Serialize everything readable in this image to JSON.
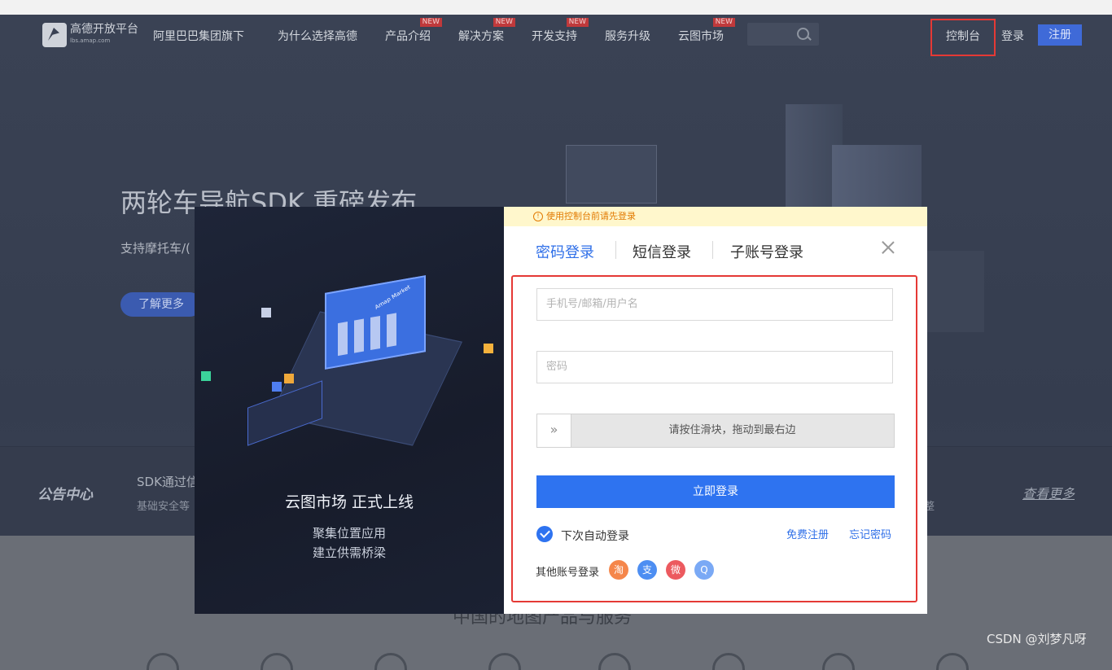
{
  "nav": {
    "logo_name": "高德开放平台",
    "logo_sub": "lbs.amap.com",
    "group": "阿里巴巴集团旗下",
    "items": [
      {
        "label": "为什么选择高德",
        "new": false
      },
      {
        "label": "产品介绍",
        "new": true
      },
      {
        "label": "解决方案",
        "new": true
      },
      {
        "label": "开发支持",
        "new": true
      },
      {
        "label": "服务升级",
        "new": false
      },
      {
        "label": "云图市场",
        "new": true
      }
    ],
    "new_badge": "NEW",
    "console": "控制台",
    "login": "登录",
    "register": "注册"
  },
  "hero": {
    "title": "两轮车导航SDK 重磅发布",
    "subtitle": "支持摩托车/(",
    "button": "了解更多"
  },
  "notice": {
    "label": "公告中心",
    "headline": "SDK通过信",
    "sub": "基础安全等",
    "sub_right": "整",
    "more": "查看更多"
  },
  "below": {
    "title": "中国的地图产品与服务"
  },
  "watermark": "CSDN @刘梦凡呀",
  "modal": {
    "promo": {
      "title": "云图市场 正式上线",
      "line1": "聚集位置应用",
      "line2": "建立供需桥梁",
      "sign": "Amap Market"
    },
    "warning": "使用控制台前请先登录",
    "tabs": [
      "密码登录",
      "短信登录",
      "子账号登录"
    ],
    "username_placeholder": "手机号/邮箱/用户名",
    "password_placeholder": "密码",
    "slider_handle": "»",
    "slider_text": "请按住滑块，拖动到最右边",
    "submit": "立即登录",
    "auto_login": "下次自动登录",
    "free_register": "免费注册",
    "forgot_password": "忘记密码",
    "other_login": "其他账号登录",
    "social": [
      {
        "name": "taobao-icon",
        "glyph": "淘",
        "color": "#f5864a"
      },
      {
        "name": "alipay-icon",
        "glyph": "支",
        "color": "#4d8ef2"
      },
      {
        "name": "weibo-icon",
        "glyph": "微",
        "color": "#ec5a5f"
      },
      {
        "name": "qq-icon",
        "glyph": "Q",
        "color": "#7aa9f5"
      }
    ]
  }
}
